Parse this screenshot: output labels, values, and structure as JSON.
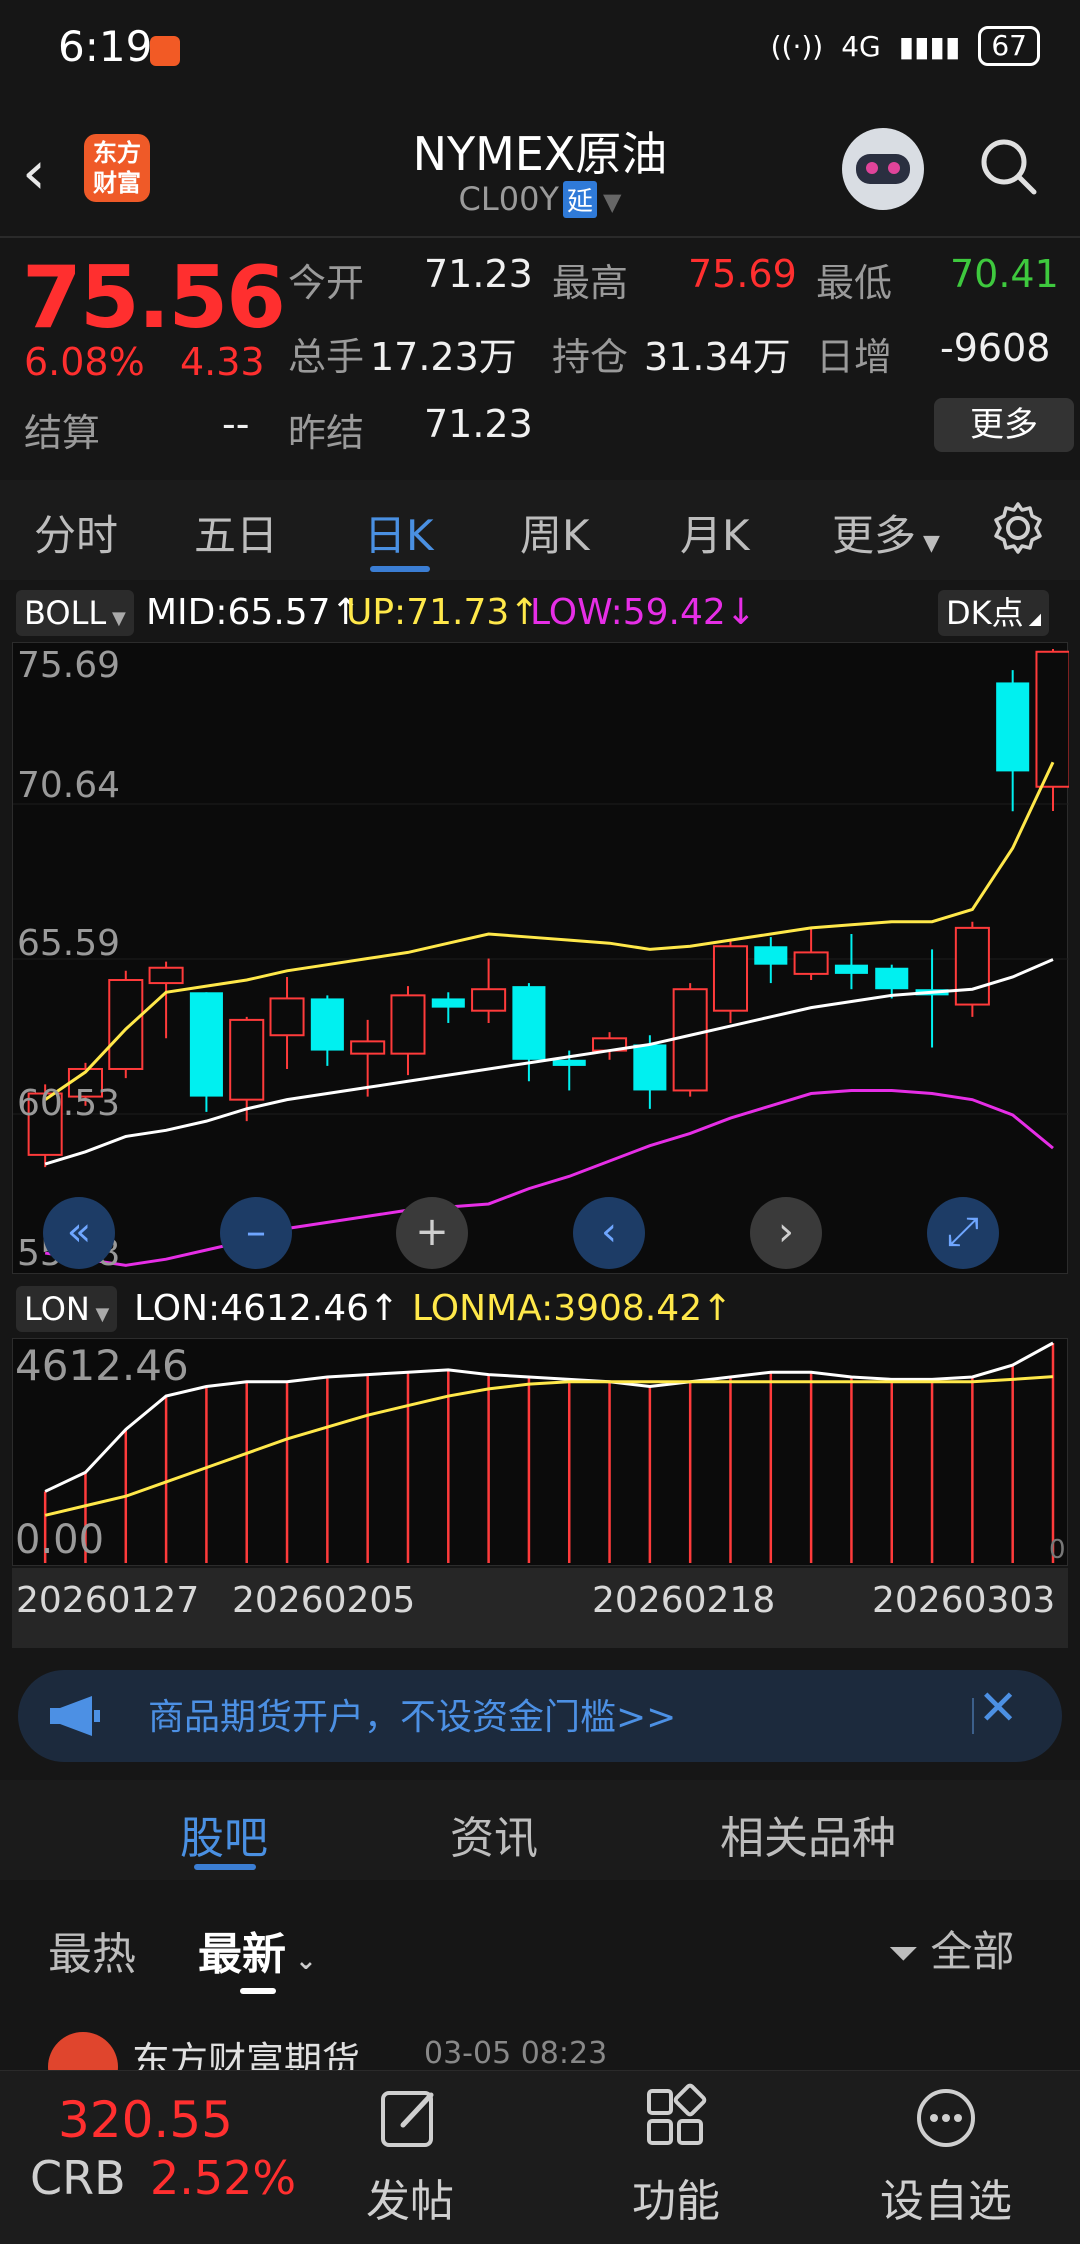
{
  "status_bar": {
    "time": "6:19",
    "signal": "4G",
    "battery": "67"
  },
  "header": {
    "back_icon": "back-arrow-icon",
    "logo_line1": "东方",
    "logo_line2": "财富",
    "title": "NYMEX原油",
    "code": "CL00Y",
    "delay_badge": "延"
  },
  "quote": {
    "price": "75.56",
    "change_pct": "6.08%",
    "change_val": "4.33",
    "open_label": "今开",
    "open": "71.23",
    "high_label": "最高",
    "high": "75.69",
    "low_label": "最低",
    "low": "70.41",
    "volume_label": "总手",
    "volume": "17.23万",
    "position_label": "持仓",
    "position": "31.34万",
    "daily_add_label": "日增",
    "daily_add": "-9608",
    "settle_label": "结算",
    "settle": "--",
    "prev_settle_label": "昨结",
    "prev_settle": "71.23",
    "more_button": "更多"
  },
  "tabs": [
    "分时",
    "五日",
    "日K",
    "周K",
    "月K",
    "更多"
  ],
  "active_tab": "日K",
  "indicator": {
    "name": "BOLL",
    "mid": "MID:65.57↑",
    "up": "UP:71.73↑",
    "low": "LOW:59.42↓",
    "dk_button": "DK点"
  },
  "sub_indicator": {
    "name": "LON",
    "lon": "LON:4612.46↑",
    "lonma": "LONMA:3908.42↑"
  },
  "chart_axis": {
    "main_ticks": [
      "75.69",
      "70.64",
      "65.59",
      "60.53",
      "55.48"
    ],
    "sub_ticks": [
      "4612.46",
      "0.00"
    ],
    "sub_right_zero": "0",
    "dates": [
      "20260127",
      "20260205",
      "20260218",
      "20260303"
    ]
  },
  "chart_data": {
    "type": "candlestick",
    "ylim": [
      55.48,
      75.69
    ],
    "candles": [
      {
        "o": 59.2,
        "c": 61.2,
        "h": 61.5,
        "l": 58.8,
        "up": true
      },
      {
        "o": 61.1,
        "c": 62.0,
        "h": 62.2,
        "l": 60.8,
        "up": true
      },
      {
        "o": 62.0,
        "c": 64.9,
        "h": 65.2,
        "l": 61.7,
        "up": true
      },
      {
        "o": 64.8,
        "c": 65.3,
        "h": 65.5,
        "l": 63.0,
        "up": true
      },
      {
        "o": 64.5,
        "c": 61.1,
        "h": 64.5,
        "l": 60.6,
        "up": false
      },
      {
        "o": 61.0,
        "c": 63.6,
        "h": 63.7,
        "l": 60.3,
        "up": true
      },
      {
        "o": 63.1,
        "c": 64.3,
        "h": 65.0,
        "l": 62.0,
        "up": true
      },
      {
        "o": 64.3,
        "c": 62.6,
        "h": 64.4,
        "l": 62.1,
        "up": false
      },
      {
        "o": 62.5,
        "c": 62.9,
        "h": 63.6,
        "l": 61.1,
        "up": true
      },
      {
        "o": 62.5,
        "c": 64.4,
        "h": 64.7,
        "l": 61.8,
        "up": true
      },
      {
        "o": 64.3,
        "c": 64.0,
        "h": 64.5,
        "l": 63.5,
        "up": false
      },
      {
        "o": 63.9,
        "c": 64.6,
        "h": 65.6,
        "l": 63.5,
        "up": true
      },
      {
        "o": 64.7,
        "c": 62.3,
        "h": 64.8,
        "l": 61.6,
        "up": false
      },
      {
        "o": 62.3,
        "c": 62.1,
        "h": 62.6,
        "l": 61.3,
        "up": false
      },
      {
        "o": 62.6,
        "c": 63.0,
        "h": 63.2,
        "l": 62.3,
        "up": true
      },
      {
        "o": 62.8,
        "c": 61.3,
        "h": 63.1,
        "l": 60.7,
        "up": false
      },
      {
        "o": 61.3,
        "c": 64.6,
        "h": 64.8,
        "l": 61.1,
        "up": true
      },
      {
        "o": 63.9,
        "c": 66.0,
        "h": 66.2,
        "l": 63.5,
        "up": true
      },
      {
        "o": 66.0,
        "c": 65.4,
        "h": 66.3,
        "l": 64.8,
        "up": false
      },
      {
        "o": 65.1,
        "c": 65.8,
        "h": 66.6,
        "l": 64.9,
        "up": true
      },
      {
        "o": 65.4,
        "c": 65.1,
        "h": 66.4,
        "l": 64.6,
        "up": false
      },
      {
        "o": 65.3,
        "c": 64.6,
        "h": 65.4,
        "l": 64.3,
        "up": false
      },
      {
        "o": 64.6,
        "c": 64.4,
        "h": 65.9,
        "l": 62.7,
        "up": false
      },
      {
        "o": 64.1,
        "c": 66.6,
        "h": 66.8,
        "l": 63.7,
        "up": true
      },
      {
        "o": 71.7,
        "c": 74.6,
        "h": 75.0,
        "l": 70.4,
        "up": false
      },
      {
        "o": 71.2,
        "c": 75.6,
        "h": 75.69,
        "l": 70.41,
        "up": true
      }
    ],
    "boll_up": [
      61.0,
      61.9,
      63.3,
      64.5,
      64.7,
      64.9,
      65.2,
      65.4,
      65.6,
      65.8,
      66.1,
      66.4,
      66.3,
      66.2,
      66.1,
      65.9,
      66.0,
      66.2,
      66.4,
      66.6,
      66.7,
      66.8,
      66.8,
      67.2,
      69.2,
      72.0
    ],
    "boll_mid": [
      58.9,
      59.3,
      59.8,
      60.0,
      60.3,
      60.7,
      61.0,
      61.2,
      61.4,
      61.6,
      61.8,
      62.0,
      62.2,
      62.4,
      62.6,
      62.8,
      63.1,
      63.4,
      63.7,
      64.0,
      64.2,
      64.4,
      64.5,
      64.6,
      65.0,
      65.57
    ],
    "boll_low": [
      56.0,
      55.8,
      55.6,
      55.8,
      56.1,
      56.4,
      56.8,
      57.0,
      57.2,
      57.4,
      57.5,
      57.6,
      58.1,
      58.5,
      59.0,
      59.5,
      59.9,
      60.4,
      60.8,
      61.2,
      61.3,
      61.3,
      61.2,
      61.0,
      60.5,
      59.42
    ],
    "lon": [
      1500,
      1900,
      2800,
      3500,
      3700,
      3800,
      3800,
      3900,
      3950,
      4000,
      4050,
      3950,
      3900,
      3850,
      3800,
      3700,
      3800,
      3900,
      4000,
      4000,
      3900,
      3850,
      3850,
      3900,
      4150,
      4612.46
    ],
    "lonma": [
      1000,
      1200,
      1400,
      1700,
      2000,
      2300,
      2600,
      2850,
      3100,
      3300,
      3500,
      3650,
      3750,
      3800,
      3800,
      3800,
      3800,
      3800,
      3800,
      3800,
      3800,
      3800,
      3800,
      3800,
      3850,
      3908.42
    ],
    "colors": {
      "up": "#ff3b3b",
      "down": "#00f0f0",
      "up_line": "#ffe84a",
      "mid_line": "#ffffff",
      "low_line": "#e62ee6"
    }
  },
  "nav_buttons": [
    "fast-back-icon",
    "zoom-out-icon",
    "zoom-in-icon",
    "prev-icon",
    "next-icon",
    "fullscreen-icon"
  ],
  "banner": {
    "text": "商品期货开户，不设资金门槛>>"
  },
  "lower_tabs": [
    "股吧",
    "资讯",
    "相关品种"
  ],
  "sort": {
    "hot": "最热",
    "latest": "最新",
    "all": "全部"
  },
  "post_peek": {
    "author": "东方财富期货",
    "time": "03-05 08:23"
  },
  "bottom_bar": {
    "crb_value": "320.55",
    "crb_label": "CRB",
    "crb_pct": "2.52%",
    "post": "发帖",
    "func": "功能",
    "watch": "设自选"
  }
}
